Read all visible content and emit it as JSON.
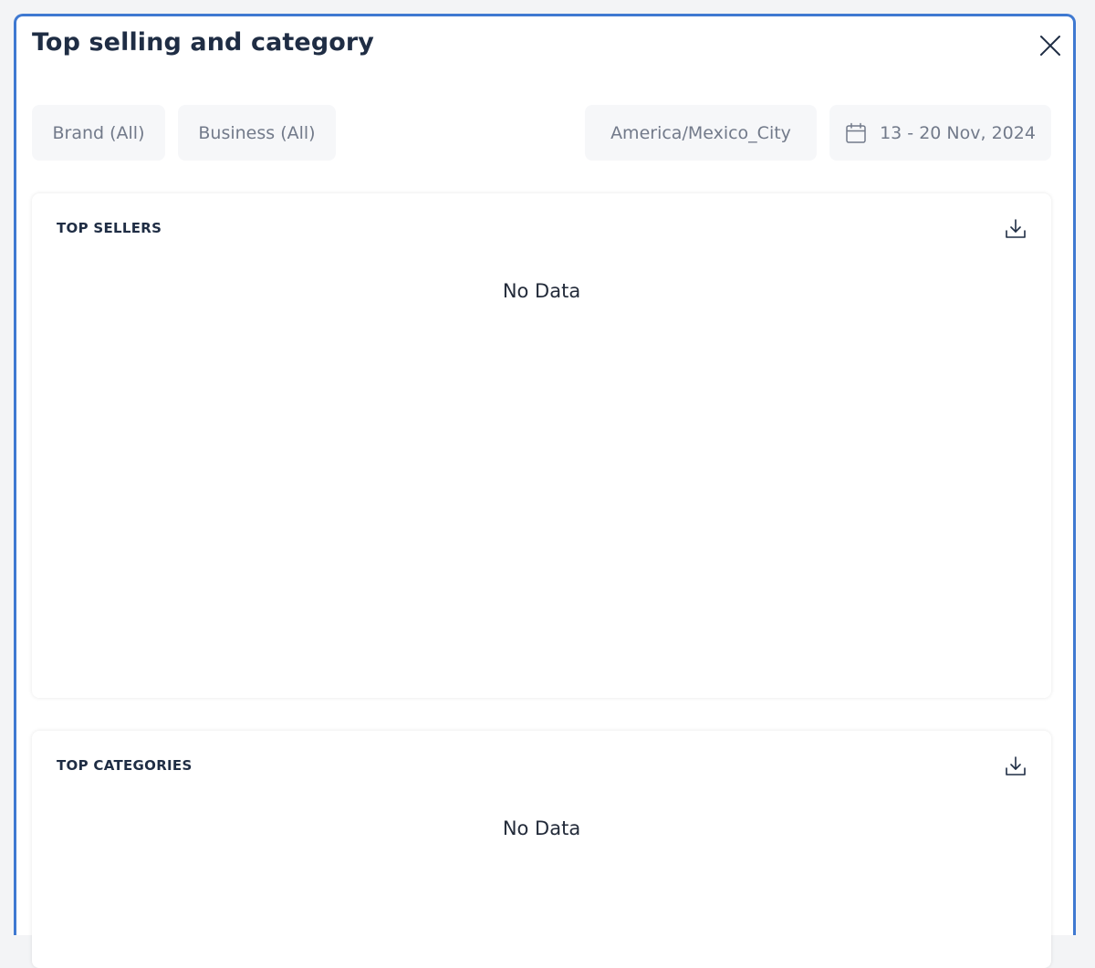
{
  "modal": {
    "title": "Top selling and category",
    "close_icon": "close-icon"
  },
  "filters": {
    "brand": "Brand (All)",
    "business": "Business (All)",
    "timezone": "America/Mexico_City",
    "date_range": "13 - 20 Nov, 2024",
    "date_icon": "calendar-icon"
  },
  "sections": {
    "top_sellers": {
      "title": "TOP SELLERS",
      "empty_text": "No Data",
      "download_icon": "download-icon"
    },
    "top_categories": {
      "title": "TOP CATEGORIES",
      "empty_text": "No Data",
      "download_icon": "download-icon"
    }
  },
  "colors": {
    "accent_border": "#3f79d1",
    "title_text": "#1f2d44",
    "pill_background": "#f6f7f9",
    "pill_text": "#727a8a"
  }
}
